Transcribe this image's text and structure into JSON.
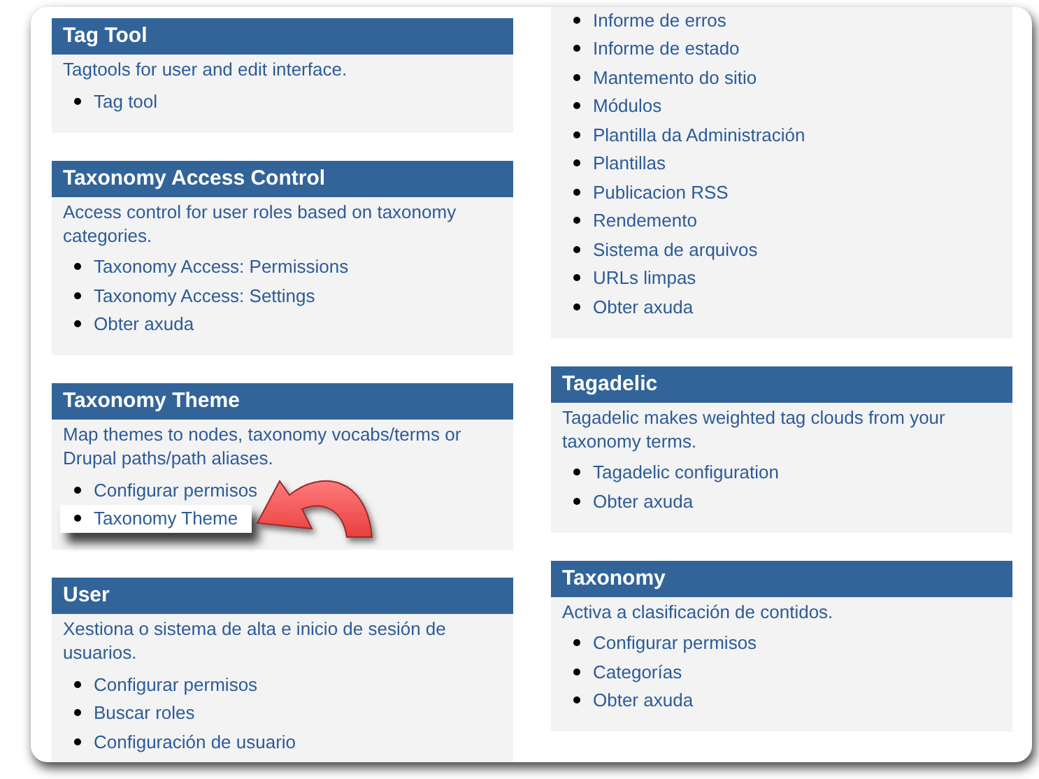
{
  "columns": [
    {
      "panels": [
        {
          "title": "Tag Tool",
          "description": "Tagtools for user and edit interface.",
          "links": [
            {
              "label": "Tag tool",
              "highlighted": false
            }
          ]
        },
        {
          "title": "Taxonomy Access Control",
          "description": "Access control for user roles based on taxonomy categories.",
          "links": [
            {
              "label": "Taxonomy Access: Permissions",
              "highlighted": false
            },
            {
              "label": "Taxonomy Access: Settings",
              "highlighted": false
            },
            {
              "label": "Obter axuda",
              "highlighted": false
            }
          ]
        },
        {
          "title": "Taxonomy Theme",
          "description": "Map themes to nodes, taxonomy vocabs/terms or Drupal paths/path aliases.",
          "links": [
            {
              "label": "Configurar permisos",
              "highlighted": false
            },
            {
              "label": "Taxonomy Theme",
              "highlighted": true
            }
          ]
        },
        {
          "title": "User",
          "description": "Xestiona o sistema de alta e inicio de sesión de usuarios.",
          "links": [
            {
              "label": "Configurar permisos",
              "highlighted": false
            },
            {
              "label": "Buscar roles",
              "highlighted": false
            },
            {
              "label": "Configuración de usuario",
              "highlighted": false
            }
          ]
        }
      ]
    },
    {
      "panels": [
        {
          "links": [
            {
              "label": "Informe de erros",
              "highlighted": false
            },
            {
              "label": "Informe de estado",
              "highlighted": false
            },
            {
              "label": "Mantemento do sitio",
              "highlighted": false
            },
            {
              "label": "Módulos",
              "highlighted": false
            },
            {
              "label": "Plantilla da Administración",
              "highlighted": false
            },
            {
              "label": "Plantillas",
              "highlighted": false
            },
            {
              "label": "Publicacion RSS",
              "highlighted": false
            },
            {
              "label": "Rendemento",
              "highlighted": false
            },
            {
              "label": "Sistema de arquivos",
              "highlighted": false
            },
            {
              "label": "URLs limpas",
              "highlighted": false
            },
            {
              "label": "Obter axuda",
              "highlighted": false
            }
          ]
        },
        {
          "title": "Tagadelic",
          "description": "Tagadelic makes weighted tag clouds from your taxonomy terms.",
          "links": [
            {
              "label": "Tagadelic configuration",
              "highlighted": false
            },
            {
              "label": "Obter axuda",
              "highlighted": false
            }
          ]
        },
        {
          "title": "Taxonomy",
          "description": "Activa a clasificación de contidos.",
          "links": [
            {
              "label": "Configurar permisos",
              "highlighted": false
            },
            {
              "label": "Categorías",
              "highlighted": false
            },
            {
              "label": "Obter axuda",
              "highlighted": false
            }
          ]
        }
      ]
    }
  ]
}
